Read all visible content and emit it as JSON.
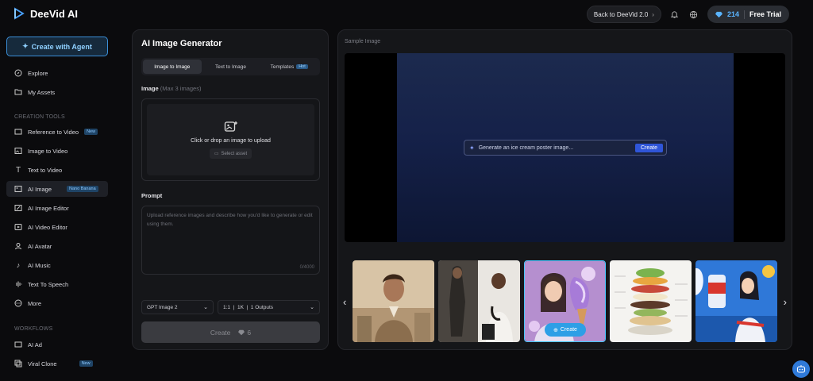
{
  "app": {
    "name": "DeeVid AI"
  },
  "topbar": {
    "back_label": "Back to DeeVid 2.0",
    "credits": "214",
    "free_trial": "Free Trial"
  },
  "sidebar": {
    "create_agent": "Create with Agent",
    "primary": [
      {
        "label": "Explore"
      },
      {
        "label": "My Assets"
      }
    ],
    "creation_tools_label": "CREATION TOOLS",
    "tools": [
      {
        "label": "Reference to Video",
        "badge": "New"
      },
      {
        "label": "Image to Video"
      },
      {
        "label": "Text to Video"
      },
      {
        "label": "AI Image",
        "badge": "Nano Banana"
      },
      {
        "label": "AI Image Editor"
      },
      {
        "label": "AI Video Editor"
      },
      {
        "label": "AI Avatar"
      },
      {
        "label": "AI Music"
      },
      {
        "label": "Text To Speech"
      },
      {
        "label": "More"
      }
    ],
    "workflows_label": "WORKFLOWS",
    "workflows": [
      {
        "label": "AI Ad"
      },
      {
        "label": "Viral Clone",
        "badge": "New"
      }
    ]
  },
  "generator": {
    "title": "AI Image Generator",
    "tabs": [
      {
        "label": "Image to Image"
      },
      {
        "label": "Text to Image"
      },
      {
        "label": "Templates",
        "badge": "Hot"
      }
    ],
    "image_label": "Image",
    "image_sub": "(Max 3 images)",
    "upload_text": "Click or drop an image to upload",
    "select_asset": "Select asset",
    "prompt_label": "Prompt",
    "prompt_placeholder": "Upload reference images and describe how you'd like to generate or edit using them.",
    "counter": "0/4000",
    "model": "GPT Image 2",
    "options": "1:1  |  1K  |  1 Outputs",
    "create_label": "Create",
    "create_cost": "6"
  },
  "sample": {
    "label": "Sample Image",
    "prompt_text": "Generate an ice cream poster image...",
    "create_label": "Create",
    "thumb_create": "Create"
  },
  "colors": {
    "accent": "#3b8fd8",
    "create_blue": "#2f55d8"
  }
}
